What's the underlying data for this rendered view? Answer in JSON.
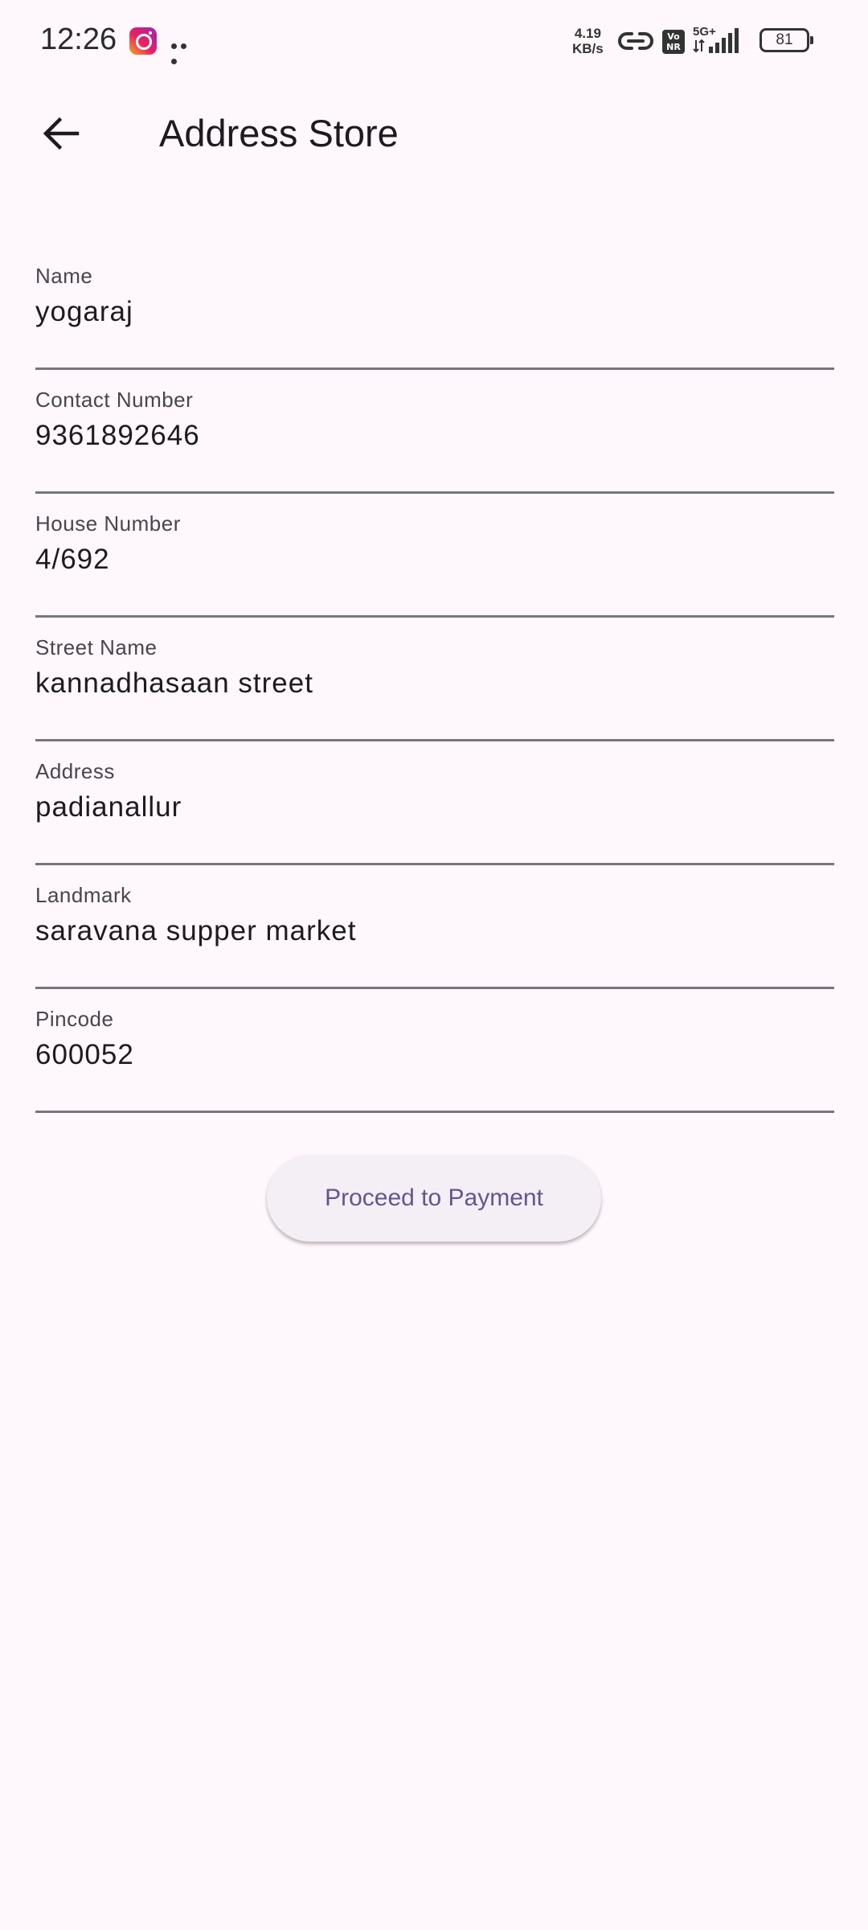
{
  "status_bar": {
    "time": "12:26",
    "net_speed_value": "4.19",
    "net_speed_unit": "KB/s",
    "volte_label_top": "Vo",
    "volte_label_bottom": "NR",
    "network_type": "5G+",
    "battery_level": "81"
  },
  "app_bar": {
    "title": "Address Store",
    "back_icon": "arrow-back-icon"
  },
  "form": {
    "fields": [
      {
        "label": "Name",
        "value": "yogaraj"
      },
      {
        "label": "Contact Number",
        "value": "9361892646"
      },
      {
        "label": "House Number",
        "value": "4/692"
      },
      {
        "label": "Street Name",
        "value": "kannadhasaan street"
      },
      {
        "label": "Address",
        "value": "padianallur"
      },
      {
        "label": "Landmark",
        "value": "saravana supper market"
      },
      {
        "label": "Pincode",
        "value": "600052"
      }
    ]
  },
  "actions": {
    "proceed_label": "Proceed to Payment"
  },
  "colors": {
    "background": "#fef7fb",
    "accent": "#65558f",
    "button_bg": "#f4eef5",
    "underline": "#79747e"
  }
}
